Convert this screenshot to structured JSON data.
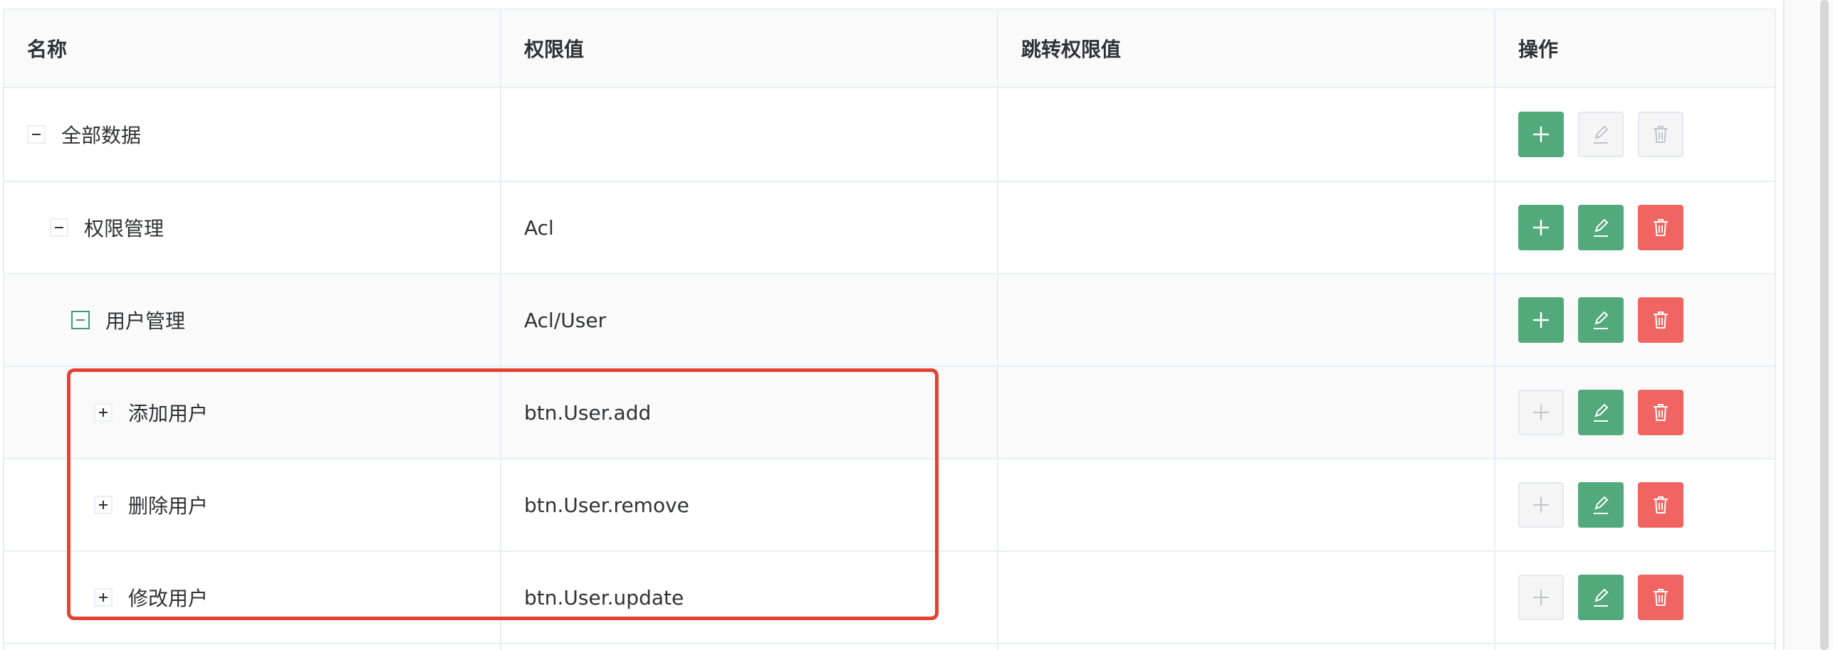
{
  "table": {
    "columns": [
      "名称",
      "权限值",
      "跳转权限值",
      "操作"
    ],
    "rows": [
      {
        "name": "全部数据",
        "code": "",
        "to_code": "",
        "expand": "minus",
        "add_enabled": true,
        "edit_enabled": false,
        "delete_enabled": false
      },
      {
        "name": "权限管理",
        "code": "Acl",
        "to_code": "",
        "expand": "minus",
        "add_enabled": true,
        "edit_enabled": true,
        "delete_enabled": true
      },
      {
        "name": "用户管理",
        "code": "Acl/User",
        "to_code": "",
        "expand": "minus-active",
        "add_enabled": true,
        "edit_enabled": true,
        "delete_enabled": true
      },
      {
        "name": "添加用户",
        "code": "btn.User.add",
        "to_code": "",
        "expand": "plus",
        "add_enabled": false,
        "edit_enabled": true,
        "delete_enabled": true
      },
      {
        "name": "删除用户",
        "code": "btn.User.remove",
        "to_code": "",
        "expand": "plus",
        "add_enabled": false,
        "edit_enabled": true,
        "delete_enabled": true
      },
      {
        "name": "修改用户",
        "code": "btn.User.update",
        "to_code": "",
        "expand": "plus",
        "add_enabled": false,
        "edit_enabled": true,
        "delete_enabled": true
      }
    ]
  },
  "icons": {
    "add": "plus-icon",
    "edit": "edit-icon",
    "delete": "trash-icon",
    "expand_open": "minus-square-icon",
    "expand_closed": "plus-square-icon"
  },
  "colors": {
    "primary": "#52a97c",
    "danger": "#f06561",
    "highlight": "#e64232",
    "disabled_bg": "#f5f5f5",
    "disabled_icon": "#c0c4cc"
  }
}
